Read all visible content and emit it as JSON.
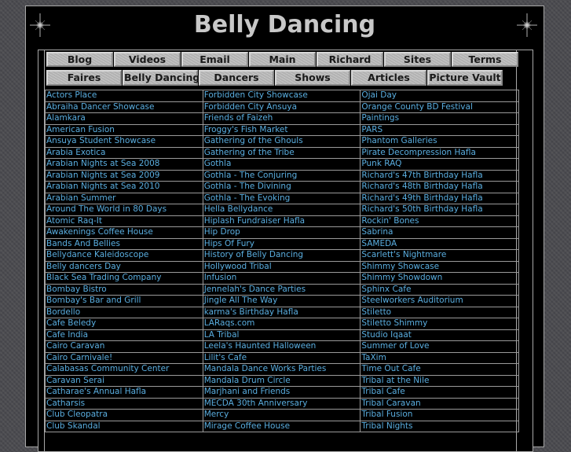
{
  "header": {
    "title": "Belly Dancing",
    "decorations": [
      "sparkle-icon",
      "sparkle-icon"
    ]
  },
  "nav": {
    "row1": [
      {
        "label": "Blog"
      },
      {
        "label": "Videos"
      },
      {
        "label": "Email"
      },
      {
        "label": "Main"
      },
      {
        "label": "Richard"
      },
      {
        "label": "Sites"
      },
      {
        "label": "Terms"
      }
    ],
    "row2": [
      {
        "label": "Faires"
      },
      {
        "label": "Belly Dancing"
      },
      {
        "label": "Dancers"
      },
      {
        "label": "Shows"
      },
      {
        "label": "Articles"
      },
      {
        "label": "Picture Vault"
      }
    ]
  },
  "colors": {
    "link": "#5aaee0",
    "background": "#000000",
    "border": "#a8a8a8",
    "title": "#c8c8c8",
    "button": "#bdbdbd"
  },
  "links": {
    "rows": [
      [
        "Actors Place",
        "Forbidden City Showcase",
        "Ojai Day"
      ],
      [
        "Abraiha Dancer Showcase",
        "Forbidden City Ansuya",
        "Orange County BD Festival"
      ],
      [
        "Alamkara",
        "Friends of Faizeh",
        "Paintings"
      ],
      [
        "American Fusion",
        "Froggy's Fish Market",
        "PARS"
      ],
      [
        "Ansuya Student Showcase",
        "Gathering of the Ghouls",
        "Phantom Galleries"
      ],
      [
        "Arabia Exotica",
        "Gathering of the Tribe",
        "Pirate Decompression Hafla"
      ],
      [
        "Arabian Nights at Sea 2008",
        "Gothla",
        "Punk RAQ"
      ],
      [
        "Arabian Nights at Sea 2009",
        "Gothla - The Conjuring",
        "Richard's 47th Birthday Hafla"
      ],
      [
        "Arabian Nights at Sea 2010",
        "Gothla - The Divining",
        "Richard's 48th Birthday Hafla"
      ],
      [
        "Arabian Summer",
        "Gothla - The Evoking",
        "Richard's 49th Birthday Hafla"
      ],
      [
        "Around The World in 80 Days",
        "Hella Bellydance",
        "Richard's 50th Birthday Hafla"
      ],
      [
        "Atomic Raq-It",
        "Hiplash Fundraiser Hafla",
        "Rockin' Bones"
      ],
      [
        "Awakenings Coffee House",
        "Hip Drop",
        "Sabrina"
      ],
      [
        "Bands And Bellies",
        "Hips Of Fury",
        "SAMEDA"
      ],
      [
        "Bellydance Kaleidoscope",
        "History of Belly Dancing",
        "Scarlett's Nightmare"
      ],
      [
        "Belly dancers Day",
        "Hollywood Tribal",
        "Shimmy Showcase"
      ],
      [
        "Black Sea Trading Company",
        "Infusion",
        "Shimmy Showdown"
      ],
      [
        "Bombay Bistro",
        "Jennelah's Dance Parties",
        "Sphinx Cafe"
      ],
      [
        "Bombay's Bar and Grill",
        "Jingle All The Way",
        "Steelworkers Auditorium"
      ],
      [
        "Bordello",
        "karma's Birthday Hafla",
        "Stiletto"
      ],
      [
        "Cafe Beledy",
        "LARaqs.com",
        "Stiletto Shimmy"
      ],
      [
        "Cafe India",
        "LA Tribal",
        "Studio Iqaat"
      ],
      [
        "Cairo Caravan",
        "Leela's Haunted Halloween",
        "Summer of Love"
      ],
      [
        "Cairo Carnivale!",
        "Lilit's Cafe",
        "TaXim"
      ],
      [
        "Calabasas Community Center",
        "Mandala Dance Works Parties",
        "Time Out Cafe"
      ],
      [
        "Caravan Serai",
        "Mandala Drum Circle",
        "Tribal at the Nile"
      ],
      [
        "Catharae's Annual Hafla",
        "Marjhani and Friends",
        "Tribal Cafe"
      ],
      [
        "Catharsis",
        "MECDA 30th Anniversary",
        "Tribal Caravan"
      ],
      [
        "Club Cleopatra",
        "Mercy",
        "Tribal Fusion"
      ],
      [
        "Club Skandal",
        "Mirage Coffee House",
        "Tribal Nights"
      ]
    ]
  }
}
